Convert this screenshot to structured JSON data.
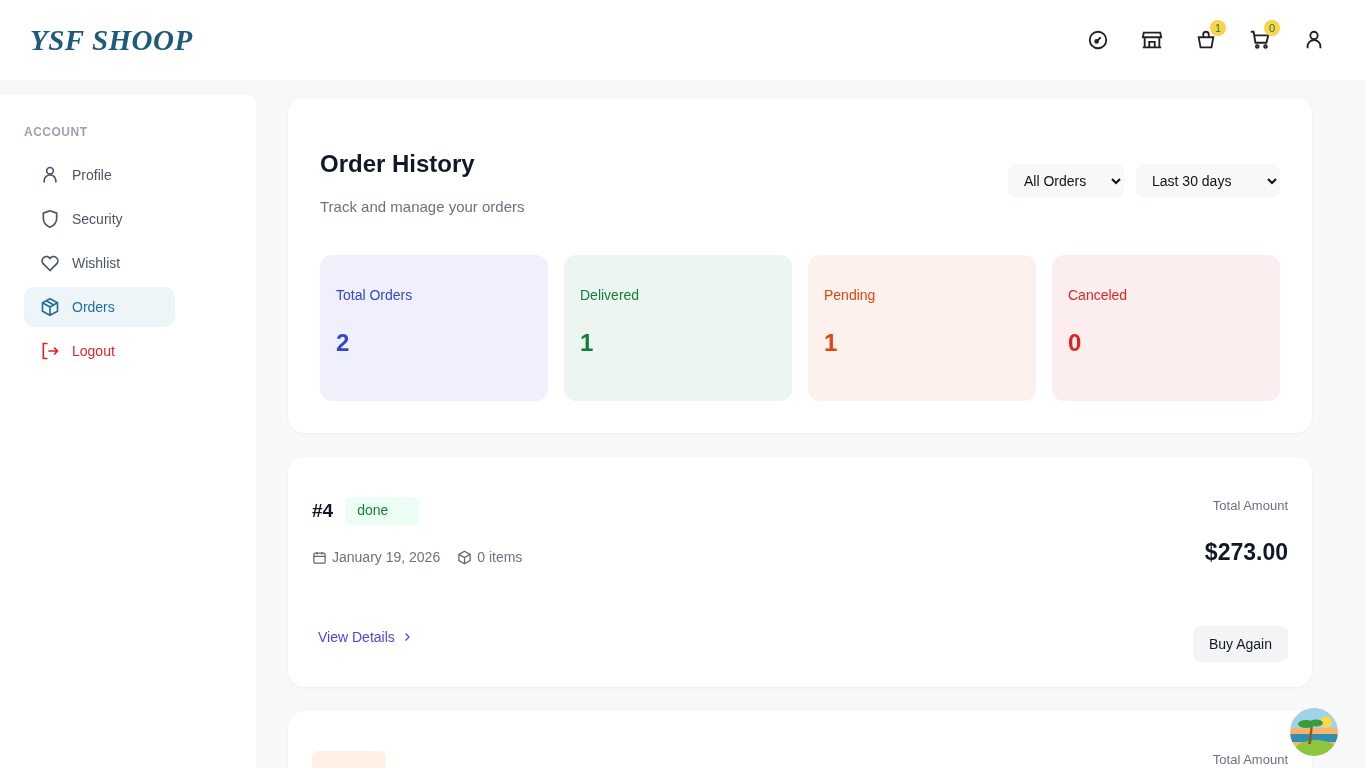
{
  "header": {
    "logo": "YSF SHOOP",
    "icons": [
      {
        "kind": "gauge"
      },
      {
        "kind": "store"
      },
      {
        "kind": "bag",
        "badge": "1"
      },
      {
        "kind": "cart",
        "badge": "0"
      },
      {
        "kind": "user"
      }
    ]
  },
  "sidebar": {
    "heading": "ACCOUNT",
    "items": [
      {
        "label": "Profile",
        "selected": false,
        "kind": "profile"
      },
      {
        "label": "Security",
        "selected": false,
        "kind": "security"
      },
      {
        "label": "Wishlist",
        "selected": false,
        "kind": "wishlist"
      },
      {
        "label": "Orders",
        "selected": true,
        "kind": "orders"
      },
      {
        "label": "Logout",
        "selected": false,
        "kind": "logout"
      }
    ]
  },
  "summary": {
    "title": "Order History",
    "subtitle": "Track and manage your orders",
    "filters": [
      "All Orders",
      "Last 30 days"
    ],
    "stats": [
      {
        "label": "Total Orders",
        "value": "2",
        "color": "#3446c9"
      },
      {
        "label": "Delivered",
        "value": "1",
        "color": "#15803d"
      },
      {
        "label": "Pending",
        "value": "1",
        "color": "#d9480f"
      },
      {
        "label": "Canceled",
        "value": "0",
        "color": "#dc2626"
      }
    ]
  },
  "orders": [
    {
      "number": "#4",
      "status": {
        "kind": "done",
        "label": "done"
      },
      "date": "January 19, 2026",
      "items": "0 items",
      "amount_label": "Total Amount",
      "amount": "$273.00",
      "link": "View Details",
      "action": "Buy Again"
    },
    {
      "status": {
        "kind": "pending"
      },
      "amount_label": "Total Amount"
    }
  ]
}
